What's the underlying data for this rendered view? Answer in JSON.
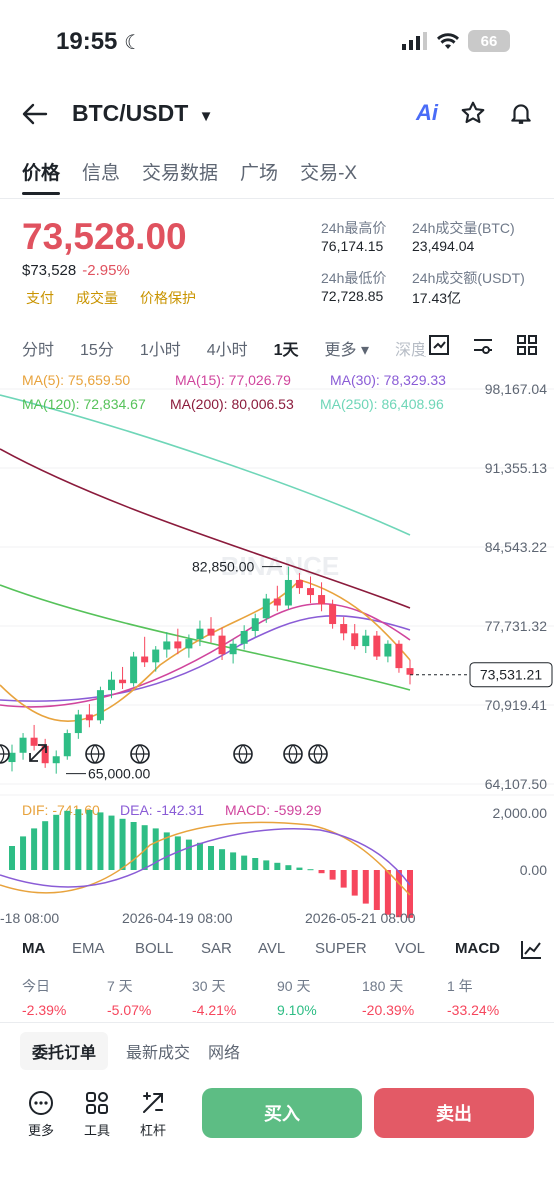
{
  "status_bar": {
    "time": "19:55",
    "battery": "66"
  },
  "header": {
    "pair": "BTC/USDT",
    "ai_label": "Ai"
  },
  "tabs": [
    "价格",
    "信息",
    "交易数据",
    "广场",
    "交易-X"
  ],
  "price": {
    "last": "73,528.00",
    "usd": "$73,528",
    "change": "-2.95%",
    "badges": [
      "支付",
      "成交量",
      "价格保护"
    ]
  },
  "stats": {
    "high_label": "24h最高价",
    "high": "76,174.15",
    "low_label": "24h最低价",
    "low": "72,728.85",
    "vol_btc_label": "24h成交量(BTC)",
    "vol_btc": "23,494.04",
    "vol_usdt_label": "24h成交额(USDT)",
    "vol_usdt": "17.43亿"
  },
  "intervals": [
    "分时",
    "15分",
    "1小时",
    "4小时",
    "1天",
    "更多 ▾",
    "深度"
  ],
  "chart_data": {
    "type": "candlestick",
    "ma_legend": [
      {
        "label": "MA(5): 75,659.50",
        "color": "#e8a33d"
      },
      {
        "label": "MA(15): 77,026.79",
        "color": "#d0459d"
      },
      {
        "label": "MA(30): 78,329.33",
        "color": "#8a5cd6"
      },
      {
        "label": "MA(120): 72,834.67",
        "color": "#56c25a"
      },
      {
        "label": "MA(200): 80,006.53",
        "color": "#8b1b3c"
      },
      {
        "label": "MA(250): 86,408.96",
        "color": "#6fd6b8"
      }
    ],
    "y_ticks": [
      "98,167.04",
      "91,355.13",
      "84,543.22",
      "77,731.32",
      "70,919.41",
      "64,107.50"
    ],
    "y_range": [
      64107.5,
      98167.04
    ],
    "current_price_label": "73,531.21",
    "annotations": {
      "high": "82,850.00",
      "low": "65,000.00"
    },
    "watermark": "BINANCE",
    "macd_legend": [
      {
        "label": "DIF: -741.60",
        "color": "#e8a33d"
      },
      {
        "label": "DEA: -142.31",
        "color": "#8a5cd6"
      },
      {
        "label": "MACD: -599.29",
        "color": "#d0459d"
      }
    ],
    "macd_ticks": [
      "2,000.00",
      "0.00"
    ],
    "x_ticks": [
      "-18 08:00",
      "2026-04-19 08:00",
      "2026-05-21 08:00"
    ],
    "ohlc": [
      [
        66000,
        67500,
        65200,
        66800
      ],
      [
        66800,
        68500,
        66200,
        68100
      ],
      [
        68100,
        69200,
        67000,
        67400
      ],
      [
        67400,
        68000,
        65500,
        65900
      ],
      [
        65900,
        67000,
        65000,
        66500
      ],
      [
        66500,
        68800,
        66200,
        68500
      ],
      [
        68500,
        70500,
        68000,
        70100
      ],
      [
        70100,
        71000,
        69000,
        69600
      ],
      [
        69600,
        72500,
        69300,
        72200
      ],
      [
        72200,
        73800,
        71500,
        73100
      ],
      [
        73100,
        74200,
        72300,
        72800
      ],
      [
        72800,
        75500,
        72500,
        75100
      ],
      [
        75100,
        76800,
        74200,
        74600
      ],
      [
        74600,
        76000,
        73800,
        75700
      ],
      [
        75700,
        77200,
        75000,
        76400
      ],
      [
        76400,
        77500,
        75300,
        75800
      ],
      [
        75800,
        77000,
        75000,
        76600
      ],
      [
        76600,
        78200,
        76000,
        77500
      ],
      [
        77500,
        78500,
        76300,
        76900
      ],
      [
        76900,
        77600,
        74800,
        75300
      ],
      [
        75300,
        76600,
        74500,
        76200
      ],
      [
        76200,
        77800,
        75700,
        77300
      ],
      [
        77300,
        78800,
        76800,
        78400
      ],
      [
        78400,
        80500,
        78000,
        80100
      ],
      [
        80100,
        81200,
        79000,
        79500
      ],
      [
        79500,
        82850,
        79200,
        81700
      ],
      [
        81700,
        82300,
        80500,
        81000
      ],
      [
        81000,
        82000,
        79700,
        80400
      ],
      [
        80400,
        81500,
        79000,
        79600
      ],
      [
        79600,
        80000,
        77500,
        77900
      ],
      [
        77900,
        78500,
        76500,
        77100
      ],
      [
        77100,
        77900,
        75700,
        76000
      ],
      [
        76000,
        77400,
        75400,
        76900
      ],
      [
        76900,
        77300,
        74800,
        75100
      ],
      [
        75100,
        76500,
        74600,
        76200
      ],
      [
        76200,
        76500,
        73700,
        74100
      ],
      [
        74100,
        74800,
        72700,
        73531
      ]
    ],
    "macd_hist": [
      300,
      420,
      520,
      610,
      690,
      740,
      760,
      750,
      720,
      680,
      640,
      600,
      560,
      520,
      470,
      420,
      380,
      340,
      300,
      260,
      220,
      180,
      150,
      120,
      90,
      60,
      30,
      10,
      -40,
      -120,
      -220,
      -320,
      -420,
      -500,
      -560,
      -590,
      -599
    ],
    "performance": [
      {
        "label": "今日",
        "value": "-2.39%"
      },
      {
        "label": "7 天",
        "value": "-5.07%"
      },
      {
        "label": "30 天",
        "value": "-4.21%"
      },
      {
        "label": "90 天",
        "value": "9.10%"
      },
      {
        "label": "180 天",
        "value": "-20.39%"
      },
      {
        "label": "1 年",
        "value": "-33.24%"
      }
    ]
  },
  "indicator_tabs": [
    "MA",
    "EMA",
    "BOLL",
    "SAR",
    "AVL",
    "SUPER",
    "VOL",
    "MACD"
  ],
  "order_tabs": [
    "委托订单",
    "最新成交",
    "网络"
  ],
  "tools": [
    {
      "icon": "more-icon",
      "label": "更多"
    },
    {
      "icon": "tools-icon",
      "label": "工具"
    },
    {
      "icon": "leverage-icon",
      "label": "杠杆"
    }
  ],
  "actions": {
    "buy": "买入",
    "sell": "卖出"
  },
  "colors": {
    "up": "#2ebd85",
    "down": "#f6465d",
    "buy": "#5dbd84",
    "sell": "#e35a66"
  }
}
